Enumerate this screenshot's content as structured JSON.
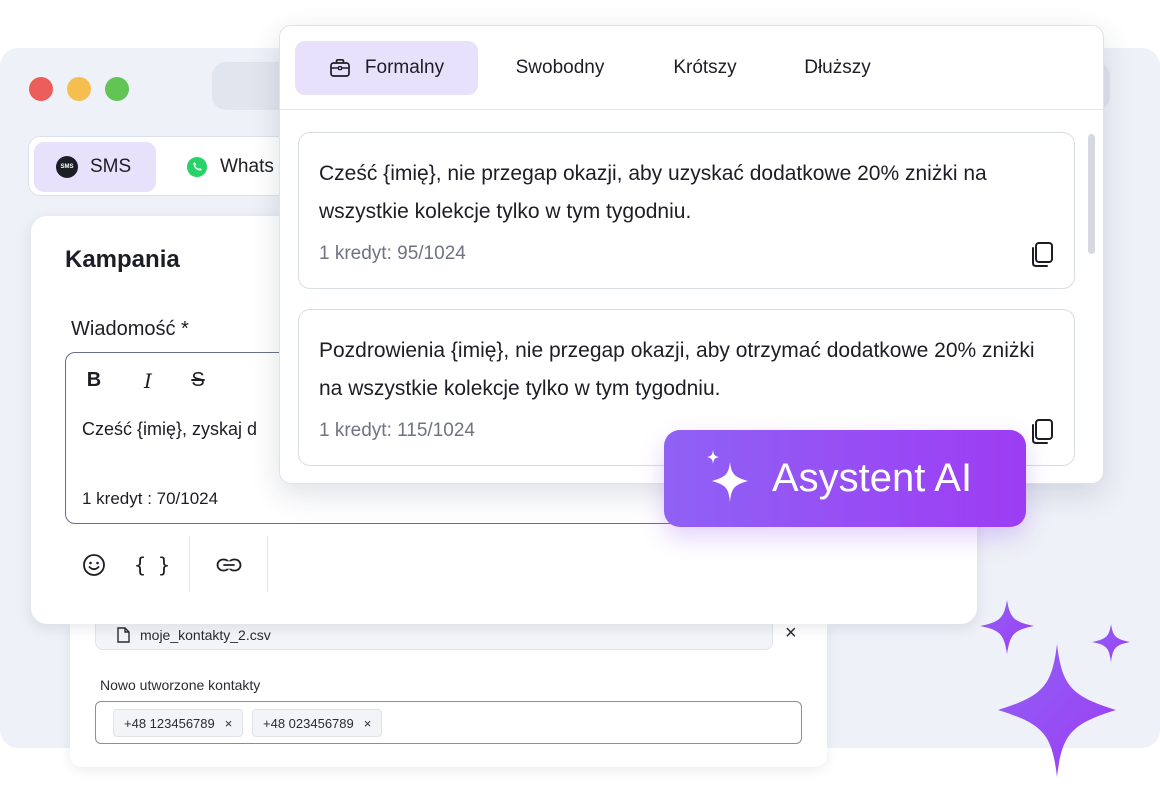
{
  "channels": {
    "sms_label": "SMS",
    "whatsapp_label": "Whats"
  },
  "campaign": {
    "title": "Kampania",
    "message_label": "Wiadomość *",
    "format": {
      "bold": "B",
      "italic": "I",
      "strike": "S"
    },
    "editor_text": "Cześć {imię}, zyskaj d",
    "editor_count": "1 kredyt : 70/1024",
    "tools": {
      "variables": "{ }"
    }
  },
  "contacts": {
    "file_name": "moje_kontakty_2.csv",
    "new_contacts_label": "Nowo utworzone kontakty",
    "chips": [
      "+48 123456789",
      "+48 023456789"
    ]
  },
  "ai_popup": {
    "tabs": [
      "Formalny",
      "Swobodny",
      "Krótszy",
      "Dłuższy"
    ],
    "active_tab": "Formalny",
    "suggestions": [
      {
        "text": "Cześć {imię}, nie przegap okazji, aby uzyskać dodatkowe 20% zniżki na wszystkie kolekcje tylko w tym tygodniu.",
        "credits": "1 kredyt: 95/1024"
      },
      {
        "text": "Pozdrowienia {imię}, nie przegap okazji, aby otrzymać dodatkowe 20% zniżki na wszystkie kolekcje tylko w tym tygodniu.",
        "credits": "1 kredyt: 115/1024"
      }
    ]
  },
  "ai_badge": {
    "label": "Asystent AI"
  },
  "colors": {
    "accent_purple": "#9a4cf4",
    "tab_active_bg": "#e8e1fb",
    "window_bg": "#eef1f7"
  }
}
